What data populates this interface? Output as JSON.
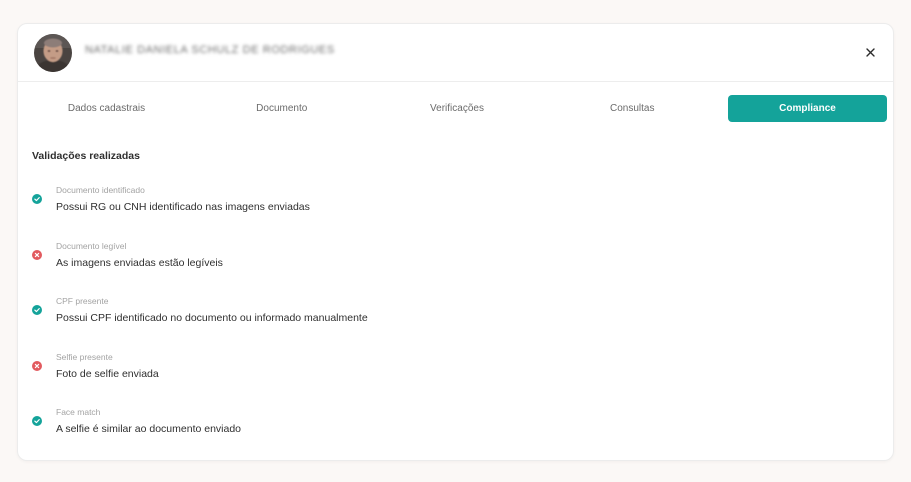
{
  "header": {
    "user_name": "NATALIE DANIELA SCHULZ DE RODRIGUES",
    "close_symbol": "×"
  },
  "tabs": [
    {
      "label": "Dados cadastrais",
      "active": false
    },
    {
      "label": "Documento",
      "active": false
    },
    {
      "label": "Verificações",
      "active": false
    },
    {
      "label": "Consultas",
      "active": false
    },
    {
      "label": "Compliance",
      "active": true
    }
  ],
  "main": {
    "section_title": "Validações realizadas",
    "validations": [
      {
        "label": "Documento identificado",
        "description": "Possui RG ou CNH identificado nas imagens enviadas",
        "status": "pass",
        "icon": "check-circle-icon"
      },
      {
        "label": "Documento legível",
        "description": "As imagens enviadas estão legíveis",
        "status": "fail",
        "icon": "x-circle-icon"
      },
      {
        "label": "CPF presente",
        "description": "Possui CPF identificado no documento ou informado manualmente",
        "status": "pass",
        "icon": "check-circle-icon"
      },
      {
        "label": "Selfie presente",
        "description": "Foto de selfie enviada",
        "status": "fail",
        "icon": "x-circle-icon"
      },
      {
        "label": "Face match",
        "description": "A selfie é similar ao documento enviado",
        "status": "pass",
        "icon": "check-circle-icon"
      }
    ]
  },
  "colors": {
    "accent": "#14a39a",
    "pass": "#14a39a",
    "fail": "#e25a5f"
  }
}
